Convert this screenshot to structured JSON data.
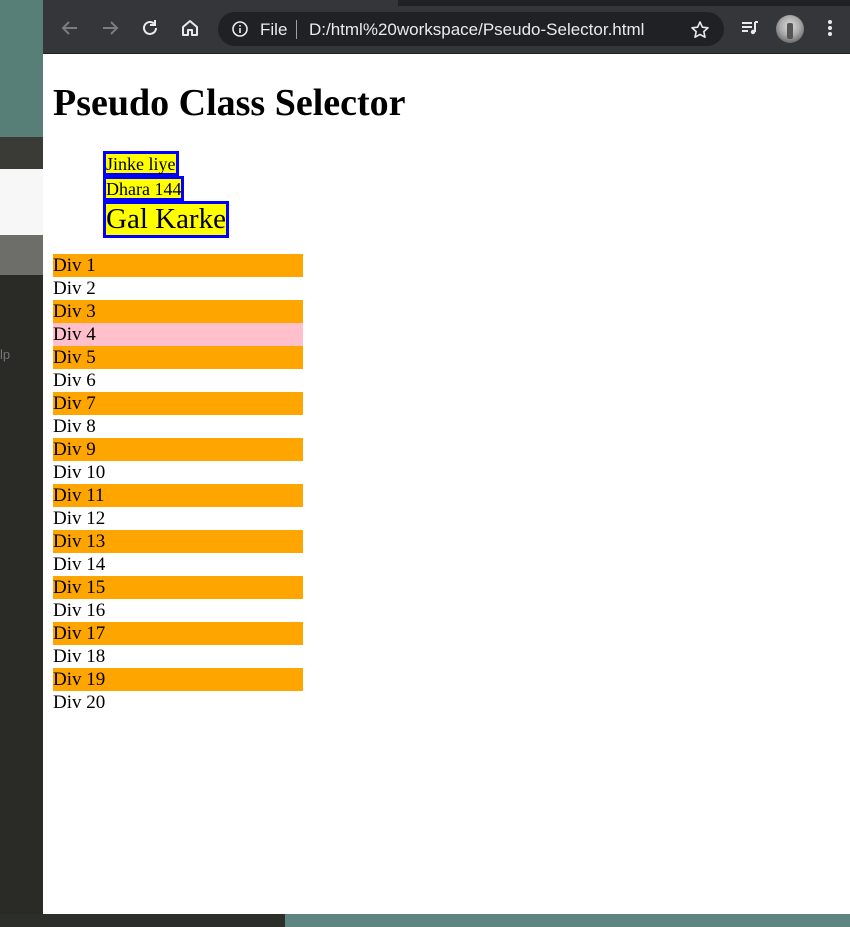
{
  "background": {
    "help_fragment": "lp"
  },
  "browser": {
    "scheme_label": "File",
    "url": "D:/html%20workspace/Pseudo-Selector.html",
    "toolbar_icons": [
      "back-arrow-icon",
      "forward-arrow-icon",
      "reload-icon",
      "home-icon",
      "info-icon",
      "bookmark-star-icon",
      "media-queue-icon",
      "profile-avatar",
      "more-menu-icon"
    ]
  },
  "page": {
    "heading": "Pseudo Class Selector",
    "pseudo_items": [
      {
        "label": "Jinke liye",
        "size": "small"
      },
      {
        "label": "Dhara 144",
        "size": "small"
      },
      {
        "label": "Gal Karke",
        "size": "big"
      }
    ],
    "divs": [
      {
        "label": "Div 1",
        "style": "orange"
      },
      {
        "label": "Div 2",
        "style": "plain"
      },
      {
        "label": "Div 3",
        "style": "orange"
      },
      {
        "label": "Div 4",
        "style": "pink"
      },
      {
        "label": "Div 5",
        "style": "orange"
      },
      {
        "label": "Div 6",
        "style": "plain"
      },
      {
        "label": "Div 7",
        "style": "orange"
      },
      {
        "label": "Div 8",
        "style": "plain"
      },
      {
        "label": "Div 9",
        "style": "orange"
      },
      {
        "label": "Div 10",
        "style": "plain"
      },
      {
        "label": "Div 11",
        "style": "orange"
      },
      {
        "label": "Div 12",
        "style": "plain"
      },
      {
        "label": "Div 13",
        "style": "orange"
      },
      {
        "label": "Div 14",
        "style": "plain"
      },
      {
        "label": "Div 15",
        "style": "orange"
      },
      {
        "label": "Div 16",
        "style": "plain"
      },
      {
        "label": "Div 17",
        "style": "orange"
      },
      {
        "label": "Div 18",
        "style": "plain"
      },
      {
        "label": "Div 19",
        "style": "orange"
      },
      {
        "label": "Div 20",
        "style": "plain"
      }
    ]
  },
  "colors": {
    "toolbar": "#35363a",
    "omnibox": "#202124",
    "pseudo_bg": "#ffff00",
    "pseudo_border": "#0000ff",
    "odd_div": "#ffa500",
    "hover_div": "#ffc0cb"
  }
}
